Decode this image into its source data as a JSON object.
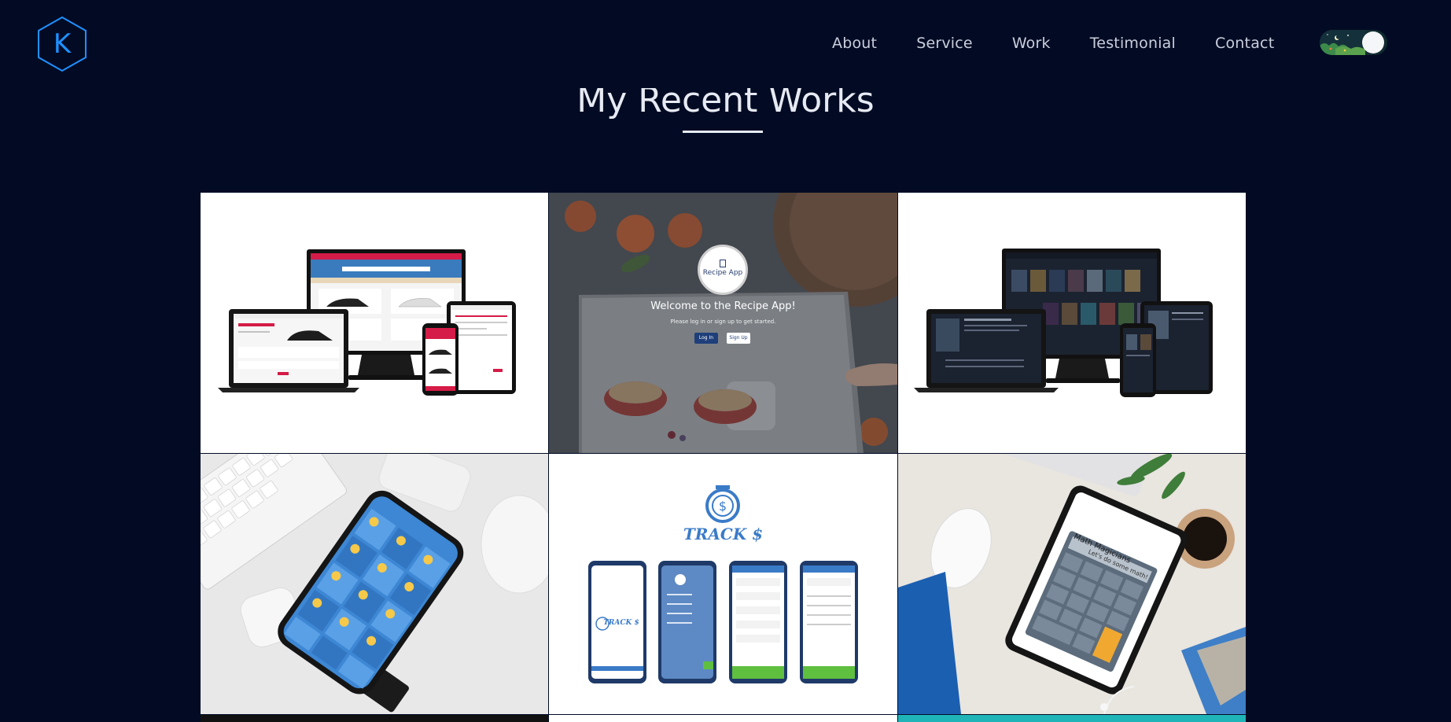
{
  "header": {
    "logo_letter": "K",
    "nav": [
      {
        "label": "About"
      },
      {
        "label": "Service"
      },
      {
        "label": "Work"
      },
      {
        "label": "Testimonial"
      },
      {
        "label": "Contact"
      }
    ],
    "theme_toggle": {
      "state": "dark"
    }
  },
  "section": {
    "title": "My Recent Works"
  },
  "works": [
    {
      "name": "car-rental-project",
      "kind": "responsive-mockup"
    },
    {
      "name": "recipe-app-project",
      "badge": "Recipe App",
      "welcome": "Welcome to the Recipe App!",
      "subtitle": "Please log in or sign up to get started.",
      "login_label": "Log In",
      "signup_label": "Sign Up"
    },
    {
      "name": "movie-app-project",
      "kind": "responsive-mockup"
    },
    {
      "name": "weather-app-project",
      "kind": "phone-mockup"
    },
    {
      "name": "tracks-budget-project",
      "brand": "TRACK $",
      "brand_small": "TRACK $"
    },
    {
      "name": "math-magicians-project",
      "app_title": "Math Magicians",
      "app_subtitle": "Let's do some math!"
    }
  ],
  "colors": {
    "background": "#020b23",
    "accent_blue": "#1e90ff",
    "brand_red": "#e31b4a",
    "tracks_blue": "#3a7bc8"
  }
}
